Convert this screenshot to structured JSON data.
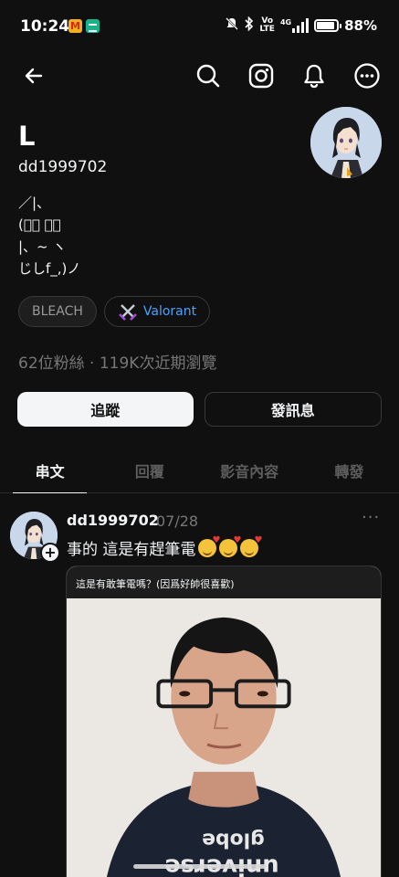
{
  "status_bar": {
    "time": "10:24",
    "battery_percent": "88%",
    "network_label_top": "Vo",
    "network_label_bottom": "LTE",
    "signal_label": "4G"
  },
  "profile": {
    "display_name": "L",
    "username": "dd1999702",
    "bio": "／|、\n(ﾟ､ ｡７\n|、~ ヽ\nじしf_,)ノ",
    "tags": [
      {
        "label": "BLEACH"
      },
      {
        "label": "Valorant",
        "icon": "crossed-swords-icon"
      }
    ],
    "stats": "62位粉絲 · 119K次近期瀏覽",
    "follow_label": "追蹤",
    "message_label": "發訊息"
  },
  "tabs": [
    {
      "label": "串文",
      "active": true
    },
    {
      "label": "回覆",
      "active": false
    },
    {
      "label": "影音內容",
      "active": false
    },
    {
      "label": "轉發",
      "active": false
    }
  ],
  "post": {
    "username": "dd1999702",
    "date": "07/28",
    "text": "事的 這是有趕筆電",
    "emoji": "smiling-face-with-hearts",
    "emoji_count": 3,
    "image_caption": "這是有敢筆電嗎？(因爲好帥很喜歡)",
    "shirt_text_1": "globe",
    "shirt_text_2": "universe"
  },
  "colors": {
    "background": "#101010",
    "text_primary": "#f3f5f7",
    "text_secondary": "#777777",
    "valorant_blue": "#4aa3ff",
    "border": "#383939"
  }
}
